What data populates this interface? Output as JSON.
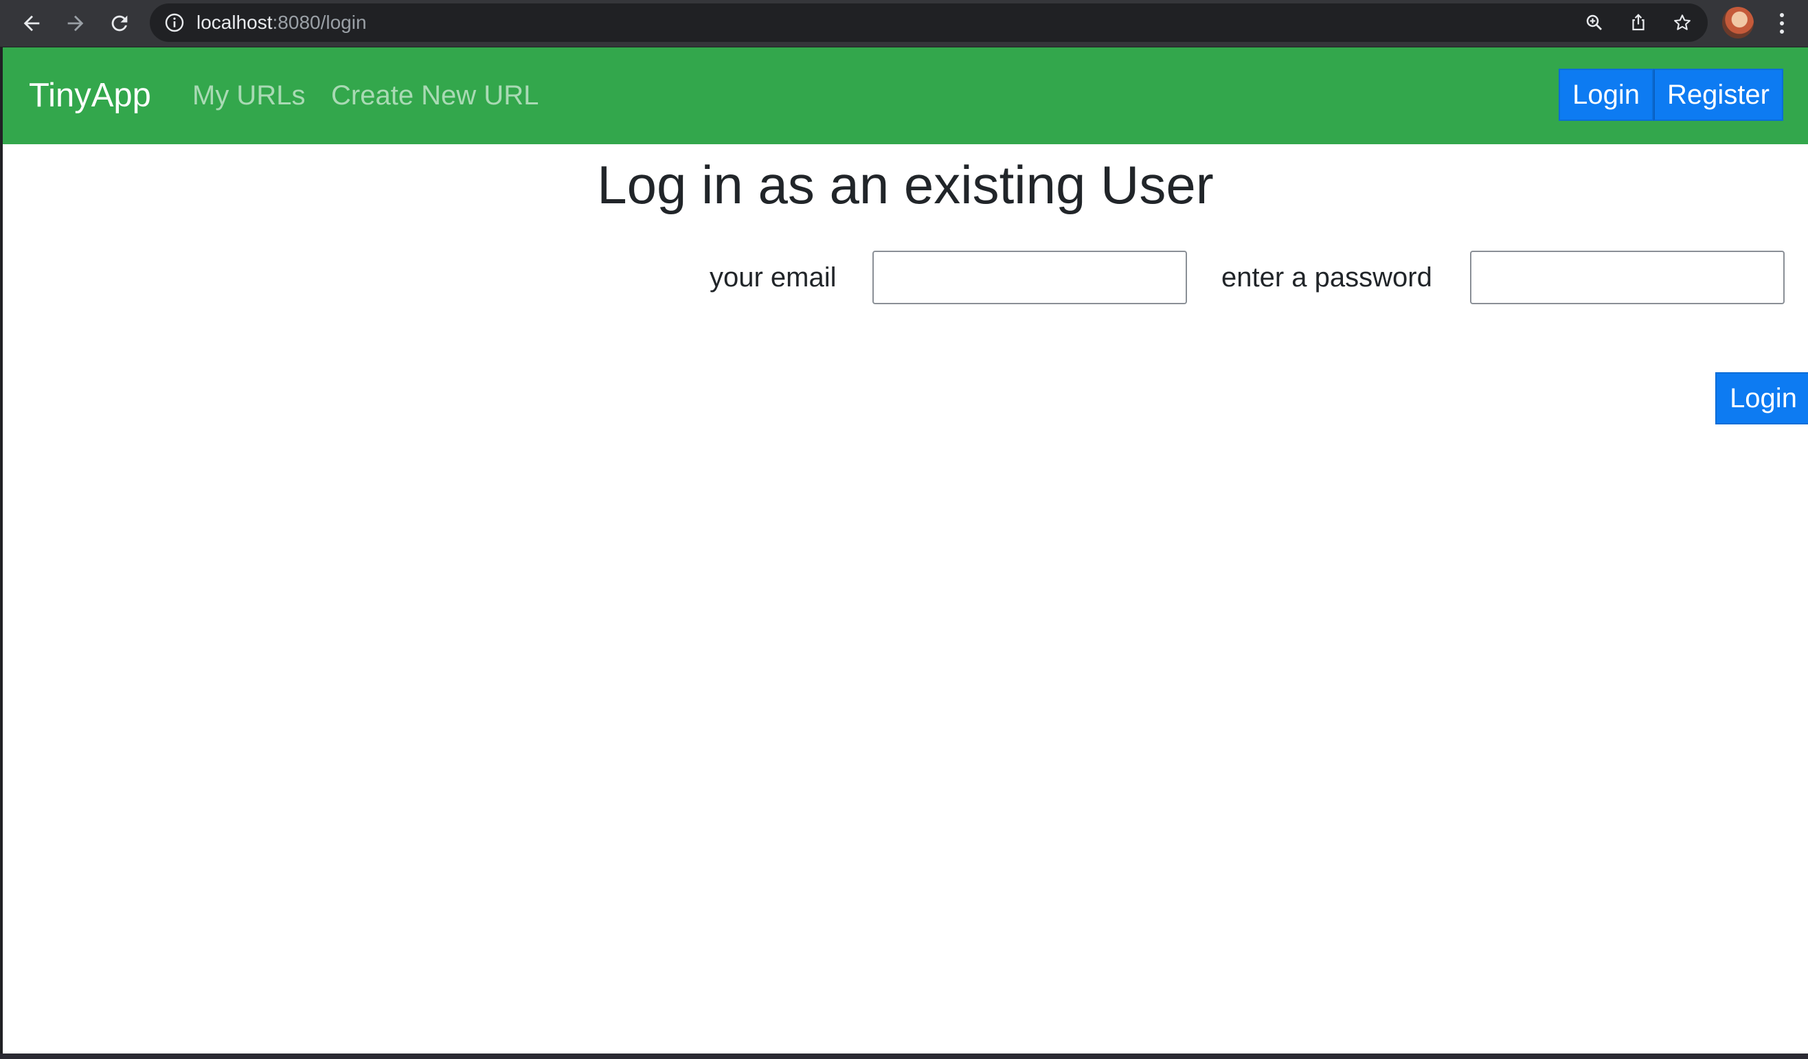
{
  "browser": {
    "url_host": "localhost",
    "url_rest": ":8080/login",
    "icons": {
      "back": "back-arrow-icon",
      "forward": "forward-arrow-icon",
      "reload": "reload-icon",
      "info": "info-icon",
      "zoom": "zoom-icon",
      "share": "share-icon",
      "bookmark": "star-icon",
      "menu": "kebab-menu-icon"
    }
  },
  "navbar": {
    "brand": "TinyApp",
    "links": [
      "My URLs",
      "Create New URL"
    ],
    "login_label": "Login",
    "register_label": "Register",
    "background": "#33a74c"
  },
  "page": {
    "heading": "Log in as an existing User",
    "email_label": "your email",
    "email_value": "",
    "password_label": "enter a password",
    "password_value": "",
    "submit_label": "Login",
    "button_color": "#0d7bf2"
  }
}
